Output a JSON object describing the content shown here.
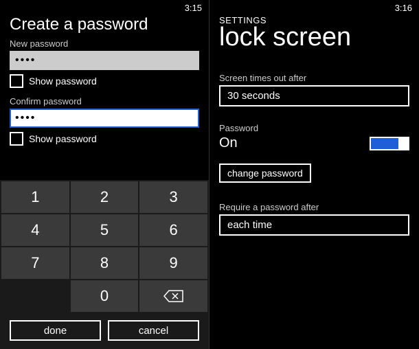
{
  "left": {
    "time": "3:15",
    "title": "Create a password",
    "new_password_label": "New password",
    "new_password_value": "••••",
    "show_password_1": "Show password",
    "confirm_password_label": "Confirm password",
    "confirm_password_value": "••••",
    "show_password_2": "Show password",
    "keypad": {
      "k1": "1",
      "k2": "2",
      "k3": "3",
      "k4": "4",
      "k5": "5",
      "k6": "6",
      "k7": "7",
      "k8": "8",
      "k9": "9",
      "k0": "0"
    },
    "done": "done",
    "cancel": "cancel"
  },
  "right": {
    "time": "3:16",
    "settings": "SETTINGS",
    "title": "lock screen",
    "timeout_label": "Screen times out after",
    "timeout_value": "30 seconds",
    "password_label": "Password",
    "password_status": "On",
    "change_password": "change password",
    "require_label": "Require a password after",
    "require_value": "each time"
  }
}
